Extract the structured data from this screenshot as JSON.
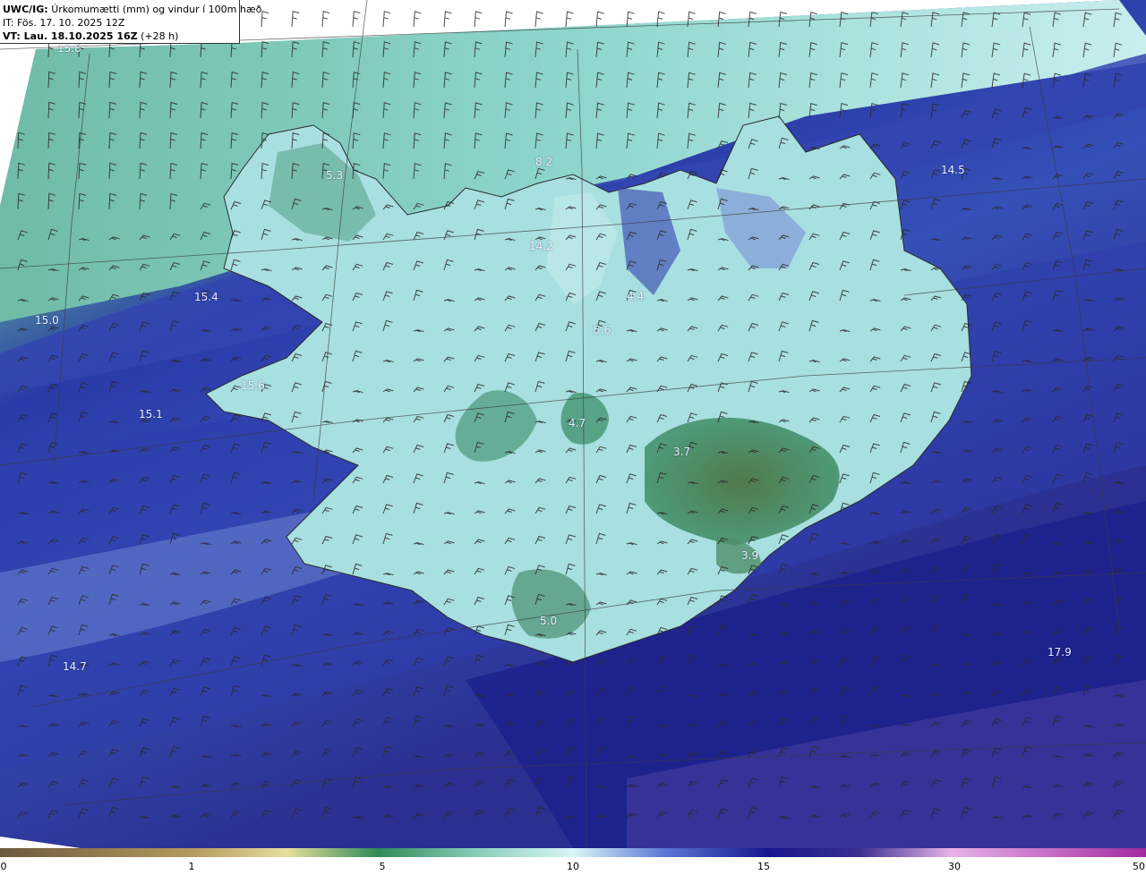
{
  "header": {
    "product": "UWC/IG:",
    "title_rest": "Úrkomumætti (mm) og vindur í 100m hæð",
    "it_line": "IT: Fös. 17. 10. 2025 12Z",
    "vt_bold": "VT: Lau. 18.10.2025 16Z",
    "vt_rest": "(+28 h)"
  },
  "map_labels": [
    "15.8",
    "5.3",
    "8.2",
    "14.5",
    "14.2",
    "15.4",
    "15.0",
    "4.4",
    "5.6",
    "15.6",
    "15.1",
    "4.7",
    "3.7",
    "3.9",
    "5.0",
    "14.7",
    "17.9"
  ],
  "colorbar": {
    "ticks": [
      "0",
      "1",
      "5",
      "10",
      "15",
      "30",
      "50"
    ],
    "colors": [
      "#6b5a3c",
      "#b59b5e",
      "#e6df9c",
      "#2e8a57",
      "#8ccfbe",
      "#d8f6f5",
      "#5a77d6",
      "#17178e",
      "#3a2f8f",
      "#e8b2e8",
      "#a12aa1"
    ]
  }
}
